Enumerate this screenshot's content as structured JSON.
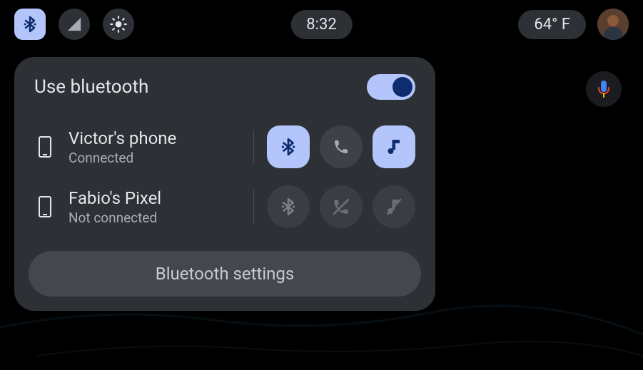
{
  "status": {
    "time": "8:32",
    "temperature": "64° F"
  },
  "bluetooth": {
    "title": "Use bluetooth",
    "enabled": true,
    "devices": [
      {
        "name": "Victor's phone",
        "status": "Connected",
        "bt_active": true,
        "phone_active": false,
        "music_active": true,
        "connected": true
      },
      {
        "name": "Fabio's Pixel",
        "status": "Not connected",
        "bt_active": false,
        "phone_active": false,
        "music_active": false,
        "connected": false
      }
    ],
    "settings_label": "Bluetooth settings"
  },
  "colors": {
    "accent": "#b4c5fb",
    "accent_dark": "#0d2d6e",
    "panel": "#2d3035",
    "button_off": "#3e4147"
  }
}
